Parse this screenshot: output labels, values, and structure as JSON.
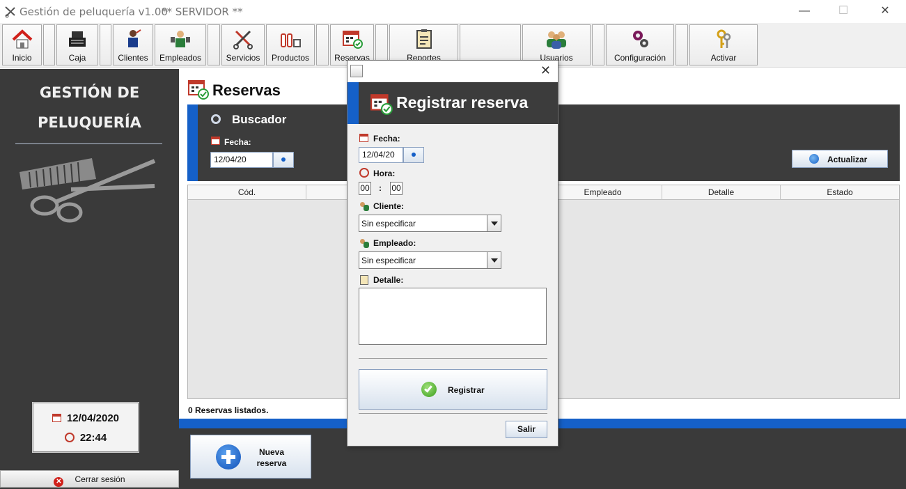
{
  "window": {
    "title": "Gestión de peluquería v1.00",
    "server_label": "** SERVIDOR **",
    "minimize": "—",
    "maximize": "☐",
    "close": "✕"
  },
  "toolbar": {
    "items": [
      {
        "label": "Inicio",
        "icon": "home-icon"
      },
      {
        "label": "Caja",
        "icon": "cash-register-icon"
      },
      {
        "label": "Clientes",
        "icon": "client-icon"
      },
      {
        "label": "Empleados",
        "icon": "employee-icon"
      },
      {
        "label": "Servicios",
        "icon": "scissors-comb-icon"
      },
      {
        "label": "Productos",
        "icon": "bottles-icon"
      },
      {
        "label": "Reservas",
        "icon": "calendar-check-icon"
      },
      {
        "label": "Reportes",
        "icon": "report-icon"
      },
      {
        "label": "Usuarios",
        "icon": "users-icon"
      },
      {
        "label": "Configuración",
        "icon": "gears-icon"
      },
      {
        "label": "Activar",
        "icon": "keys-icon"
      }
    ]
  },
  "sidebar": {
    "brand_line1": "GESTIÓN DE",
    "brand_line2": "PELUQUERÍA",
    "date": "12/04/2020",
    "time": "22:44",
    "logout_label": "Cerrar sesión"
  },
  "main": {
    "title": "Reservas",
    "search": {
      "header": "Buscador",
      "date_label": "Fecha:",
      "date_value": "12/04/20"
    },
    "refresh_label": "Actualizar",
    "table": {
      "columns": [
        "Cód.",
        "",
        "",
        "Empleado",
        "Detalle",
        "Estado"
      ]
    },
    "count_text": "0 Reservas listados.",
    "new_button_line1": "Nueva",
    "new_button_line2": "reserva"
  },
  "dialog": {
    "close": "✕",
    "title": "Registrar reserva",
    "fecha_label": "Fecha:",
    "fecha_value": "12/04/20",
    "hora_label": "Hora:",
    "hour": "00",
    "colon": ":",
    "minute": "00",
    "cliente_label": "Cliente:",
    "cliente_value": "Sin especificar",
    "empleado_label": "Empleado:",
    "empleado_value": "Sin especificar",
    "detalle_label": "Detalle:",
    "register_label": "Registrar",
    "exit_label": "Salir"
  }
}
